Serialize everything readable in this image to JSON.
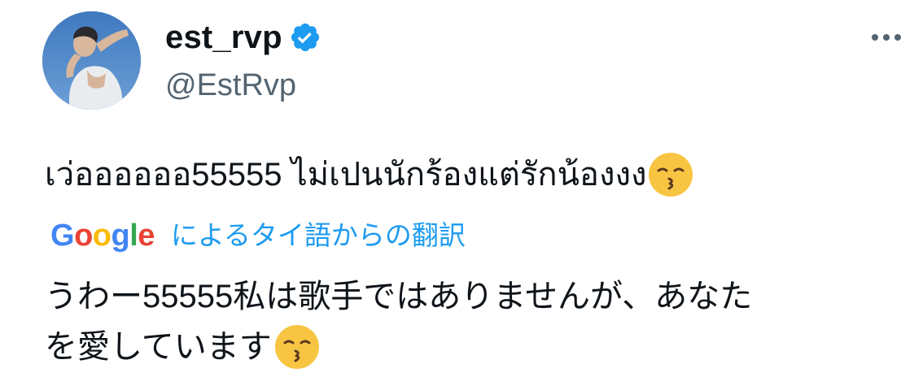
{
  "tweet": {
    "author": {
      "display_name": "est_rvp",
      "handle": "@EstRvp",
      "verified": true,
      "verified_color": "#1d9bf0"
    },
    "original_text": "เว่ออออออ55555 ไม่เปนนักร้องแต่รักน้องงง",
    "emoji": "kissing-face",
    "translation": {
      "provider_logo": {
        "letters": [
          "G",
          "o",
          "o",
          "g",
          "l",
          "e"
        ]
      },
      "label": "によるタイ語からの翻訳",
      "text_line1": "うわー55555私は歌手ではありませんが、あなた",
      "text_line2": "を愛しています"
    },
    "colors": {
      "text": "#0f1419",
      "secondary": "#536471",
      "link": "#1d9bf0",
      "google_blue": "#4285f4",
      "google_red": "#ea4335",
      "google_yellow": "#fbbc05",
      "google_green": "#34a853"
    }
  }
}
